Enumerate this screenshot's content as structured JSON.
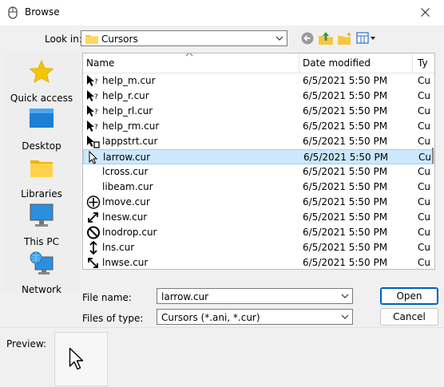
{
  "window": {
    "title": "Browse",
    "close_icon": "close-icon"
  },
  "toolbar": {
    "look_in_label": "Look in:",
    "look_in_value": "Cursors",
    "back_icon": "back-arrow-icon",
    "up_icon": "up-folder-icon",
    "new_folder_icon": "new-folder-icon",
    "view_icon": "view-menu-icon"
  },
  "places": [
    {
      "label": "Quick access",
      "icon": "star-icon"
    },
    {
      "label": "Desktop",
      "icon": "desktop-icon"
    },
    {
      "label": "Libraries",
      "icon": "libraries-icon"
    },
    {
      "label": "This PC",
      "icon": "computer-icon"
    },
    {
      "label": "Network",
      "icon": "network-icon"
    }
  ],
  "file_list": {
    "columns": {
      "name": "Name",
      "date": "Date modified",
      "type": "Ty"
    },
    "rows": [
      {
        "name": "help_m.cur",
        "date": "6/5/2021 5:50 PM",
        "type": "Cu",
        "icon": "help-cursor-icon"
      },
      {
        "name": "help_r.cur",
        "date": "6/5/2021 5:50 PM",
        "type": "Cu",
        "icon": "help-cursor-icon"
      },
      {
        "name": "help_rl.cur",
        "date": "6/5/2021 5:50 PM",
        "type": "Cu",
        "icon": "help-cursor-icon"
      },
      {
        "name": "help_rm.cur",
        "date": "6/5/2021 5:50 PM",
        "type": "Cu",
        "icon": "help-cursor-icon"
      },
      {
        "name": "lappstrt.cur",
        "date": "6/5/2021 5:50 PM",
        "type": "Cu",
        "icon": "appstarting-cursor-icon"
      },
      {
        "name": "larrow.cur",
        "date": "6/5/2021 5:50 PM",
        "type": "Cu",
        "icon": "arrow-cursor-icon",
        "selected": true
      },
      {
        "name": "lcross.cur",
        "date": "6/5/2021 5:50 PM",
        "type": "Cu",
        "icon": ""
      },
      {
        "name": "libeam.cur",
        "date": "6/5/2021 5:50 PM",
        "type": "Cu",
        "icon": ""
      },
      {
        "name": "lmove.cur",
        "date": "6/5/2021 5:50 PM",
        "type": "Cu",
        "icon": "move-cursor-icon"
      },
      {
        "name": "lnesw.cur",
        "date": "6/5/2021 5:50 PM",
        "type": "Cu",
        "icon": "resize-nesw-cursor-icon"
      },
      {
        "name": "lnodrop.cur",
        "date": "6/5/2021 5:50 PM",
        "type": "Cu",
        "icon": "nodrop-cursor-icon"
      },
      {
        "name": "lns.cur",
        "date": "6/5/2021 5:50 PM",
        "type": "Cu",
        "icon": "resize-ns-cursor-icon"
      },
      {
        "name": "lnwse.cur",
        "date": "6/5/2021 5:50 PM",
        "type": "Cu",
        "icon": "resize-nwse-cursor-icon"
      }
    ]
  },
  "file_name": {
    "label": "File name:",
    "value": "larrow.cur"
  },
  "file_type": {
    "label": "Files of type:",
    "value": "Cursors (*.ani, *.cur)"
  },
  "buttons": {
    "open": "Open",
    "cancel": "Cancel"
  },
  "preview": {
    "label": "Preview:",
    "icon": "arrow-cursor-icon"
  }
}
